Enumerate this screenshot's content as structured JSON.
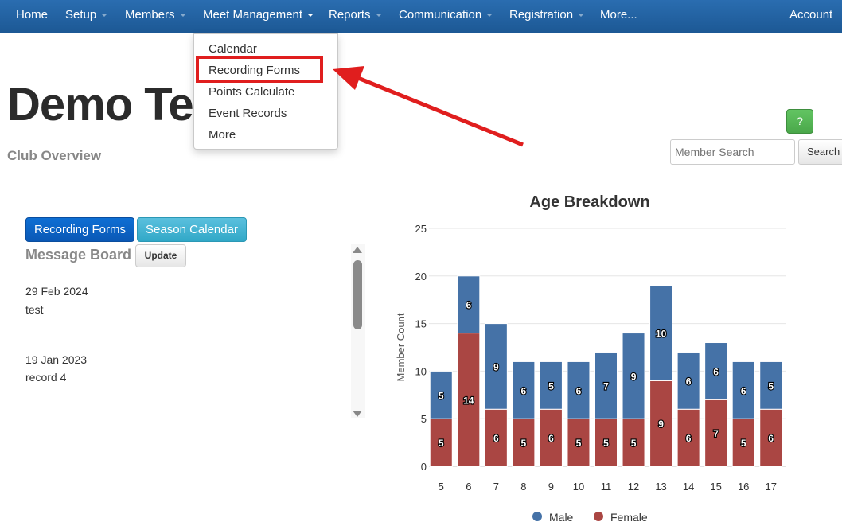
{
  "nav": {
    "items": [
      {
        "label": "Home",
        "caret": false
      },
      {
        "label": "Setup",
        "caret": true
      },
      {
        "label": "Members",
        "caret": true
      },
      {
        "label": "Meet Management",
        "caret": true
      },
      {
        "label": "Reports",
        "caret": true
      },
      {
        "label": "Communication",
        "caret": true
      },
      {
        "label": "Registration",
        "caret": true
      },
      {
        "label": "More...",
        "caret": false
      }
    ],
    "account": "Account"
  },
  "dropdown": {
    "items": [
      "Calendar",
      "Recording Forms",
      "Points Calculate",
      "Event Records",
      "More"
    ],
    "highlighted": "Recording Forms",
    "highlight_color": "#e01e1e"
  },
  "page": {
    "title": "Demo Te",
    "subtitle": "Club Overview"
  },
  "help_button": "?",
  "search": {
    "placeholder": "Member Search",
    "button": "Search"
  },
  "buttons": {
    "recording_forms": "Recording Forms",
    "season_calendar": "Season Calendar"
  },
  "message_board": {
    "title": "Message Board",
    "update": "Update",
    "messages": [
      {
        "date": "29 Feb 2024",
        "text": "test"
      },
      {
        "date": "19 Jan 2023",
        "text": "record 4"
      }
    ]
  },
  "chart_data": {
    "type": "bar",
    "stacked": true,
    "title": "Age Breakdown",
    "xlabel": "",
    "ylabel": "Member Count",
    "categories": [
      "5",
      "6",
      "7",
      "8",
      "9",
      "10",
      "11",
      "12",
      "13",
      "14",
      "15",
      "16",
      "17"
    ],
    "ylim": [
      0,
      25
    ],
    "yticks": [
      0,
      5,
      10,
      15,
      20,
      25
    ],
    "series": [
      {
        "name": "Female",
        "color": "#aa4643",
        "values": [
          5,
          14,
          6,
          5,
          6,
          5,
          5,
          5,
          9,
          6,
          7,
          5,
          6
        ]
      },
      {
        "name": "Male",
        "color": "#4572a7",
        "values": [
          5,
          6,
          9,
          6,
          5,
          6,
          7,
          9,
          10,
          6,
          6,
          6,
          5
        ]
      }
    ],
    "legend": [
      "Male",
      "Female"
    ],
    "legend_position": "bottom",
    "grid": true
  }
}
